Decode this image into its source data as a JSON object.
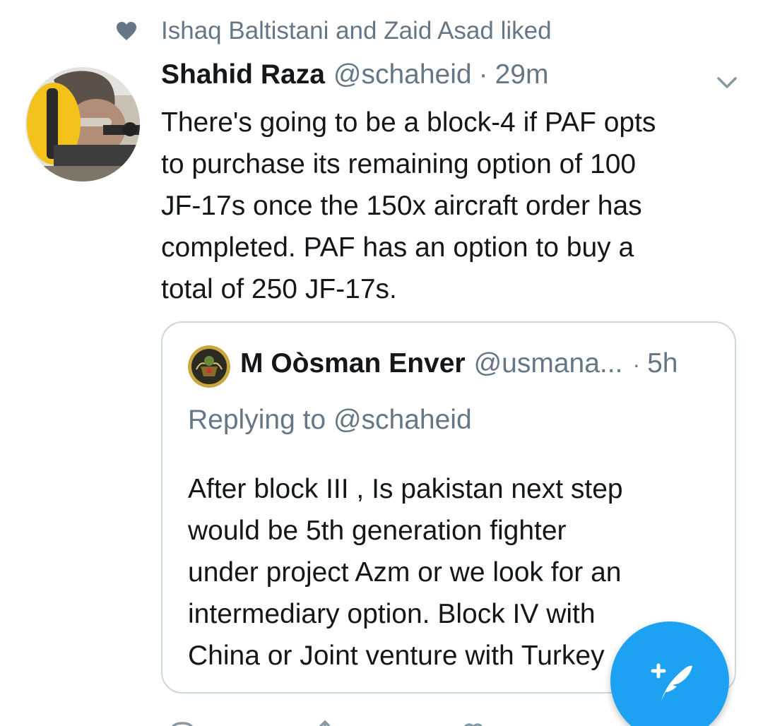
{
  "social_context": {
    "icon": "heart-icon",
    "text": "Ishaq Baltistani and Zaid Asad liked"
  },
  "tweet": {
    "author_name": "Shahid Raza",
    "author_handle": "@schaheid",
    "separator": "·",
    "timestamp": "29m",
    "menu_icon": "chevron-down-icon",
    "text": "There's going to be a block-4 if PAF opts\nto purchase its remaining option of 100\nJF-17s once the 150x aircraft order has\ncompleted. PAF has an option to buy a\ntotal of 250 JF-17s."
  },
  "quoted_tweet": {
    "author_name": "M Oòsman Enver",
    "author_handle": "@usmana...",
    "separator": "·",
    "timestamp": "5h",
    "replying_to": "Replying to @schaheid",
    "text": "After block III , Is pakistan next step\nwould be 5th generation fighter\nunder project Azm or we look for an\nintermediary option.  Block IV with\nChina or Joint venture with Turkey"
  },
  "fab": {
    "icon": "compose-tweet-icon"
  },
  "action_bar": {
    "icons": [
      "reply-icon",
      "retweet-icon",
      "like-icon"
    ]
  },
  "colors": {
    "accent": "#1da1f2",
    "secondary_text": "#657786",
    "primary_text": "#14171a",
    "border": "#ccd6dd"
  }
}
